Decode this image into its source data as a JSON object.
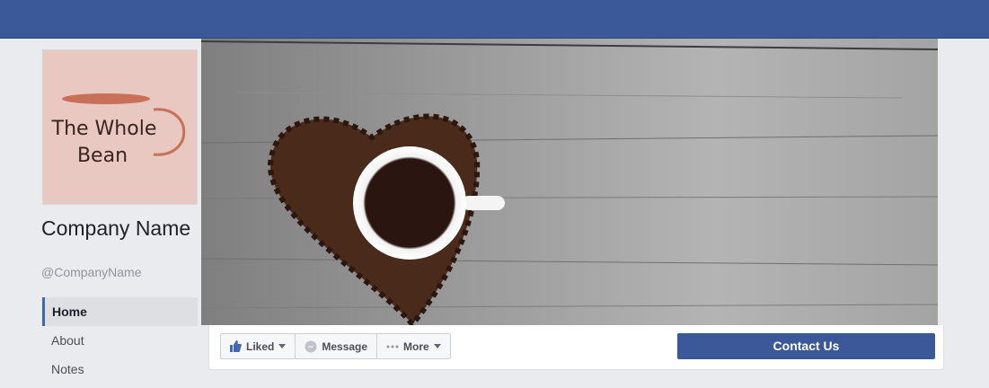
{
  "page": {
    "name": "Company Name",
    "handle": "@CompanyName"
  },
  "logo": {
    "text_line1": "The Whole",
    "text_line2": "Bean"
  },
  "nav": {
    "items": [
      {
        "label": "Home"
      },
      {
        "label": "About"
      },
      {
        "label": "Notes"
      }
    ]
  },
  "actions": {
    "liked": "Liked",
    "message": "Message",
    "more": "More",
    "contact": "Contact Us"
  },
  "colors": {
    "brand": "#3b5998",
    "background": "#e9ebee",
    "logo_bg": "#e8c8c0",
    "logo_accent": "#c87058"
  },
  "icons": {
    "liked": "thumbs-up-icon",
    "message": "messenger-icon",
    "more": "ellipsis-icon"
  }
}
